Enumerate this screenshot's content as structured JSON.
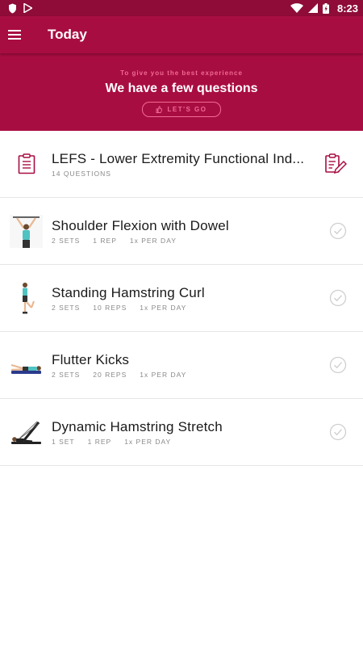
{
  "status_bar": {
    "time": "8:23",
    "icons": [
      "shield-icon",
      "play-store-icon",
      "wifi-icon",
      "signal-icon",
      "battery-icon"
    ]
  },
  "app_bar": {
    "title": "Today",
    "menu_icon": "menu-icon"
  },
  "banner": {
    "subtitle": "To give you the best experience",
    "title": "We have a few questions",
    "button_label": "LET'S GO",
    "colors": {
      "background": "#a80d41",
      "accent": "#f06a95"
    }
  },
  "questionnaire": {
    "title": "LEFS - Lower Extremity Functional Ind...",
    "meta": "14 QUESTIONS",
    "icon": "clipboard-icon",
    "action_icon": "clipboard-edit-icon"
  },
  "exercises": [
    {
      "title": "Shoulder Flexion with Dowel",
      "sets": "2 SETS",
      "reps": "1 REP",
      "frequency": "1x PER DAY"
    },
    {
      "title": "Standing Hamstring Curl",
      "sets": "2 SETS",
      "reps": "10 REPS",
      "frequency": "1x PER DAY"
    },
    {
      "title": "Flutter Kicks",
      "sets": "2 SETS",
      "reps": "20 REPS",
      "frequency": "1x PER DAY"
    },
    {
      "title": "Dynamic Hamstring Stretch",
      "sets": "1 SET",
      "reps": "1 REP",
      "frequency": "1x PER DAY"
    }
  ]
}
